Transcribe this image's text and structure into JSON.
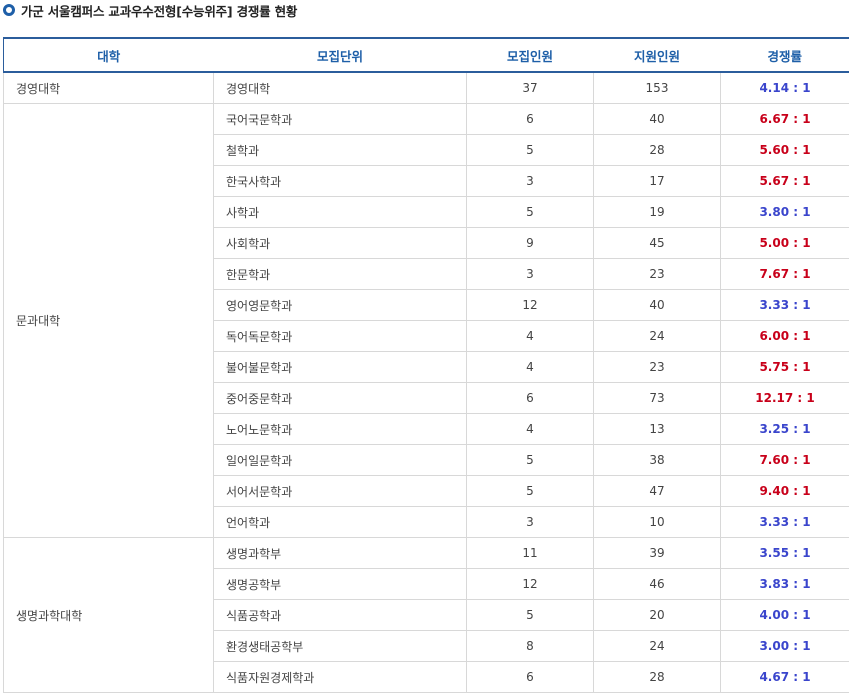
{
  "page": {
    "title": "가군 서울캠퍼스 교과우수전형[수능위주] 경쟁률 현황"
  },
  "table": {
    "headers": [
      "대학",
      "모집단위",
      "모집인원",
      "지원인원",
      "경쟁률"
    ],
    "colors": {
      "high": "#c8001a",
      "low": "#3a45cc",
      "header": "#1e5fa8"
    },
    "rows": [
      {
        "college": "경영대학",
        "rowspan": 1,
        "unit": "경영대학",
        "quota": "37",
        "applicants": "153",
        "ratio": "4.14 : 1",
        "level": "low"
      },
      {
        "college": "문과대학",
        "rowspan": 14,
        "unit": "국어국문학과",
        "quota": "6",
        "applicants": "40",
        "ratio": "6.67 : 1",
        "level": "high"
      },
      {
        "unit": "철학과",
        "quota": "5",
        "applicants": "28",
        "ratio": "5.60 : 1",
        "level": "high"
      },
      {
        "unit": "한국사학과",
        "quota": "3",
        "applicants": "17",
        "ratio": "5.67 : 1",
        "level": "high"
      },
      {
        "unit": "사학과",
        "quota": "5",
        "applicants": "19",
        "ratio": "3.80 : 1",
        "level": "low"
      },
      {
        "unit": "사회학과",
        "quota": "9",
        "applicants": "45",
        "ratio": "5.00 : 1",
        "level": "high"
      },
      {
        "unit": "한문학과",
        "quota": "3",
        "applicants": "23",
        "ratio": "7.67 : 1",
        "level": "high"
      },
      {
        "unit": "영어영문학과",
        "quota": "12",
        "applicants": "40",
        "ratio": "3.33 : 1",
        "level": "low"
      },
      {
        "unit": "독어독문학과",
        "quota": "4",
        "applicants": "24",
        "ratio": "6.00 : 1",
        "level": "high"
      },
      {
        "unit": "불어불문학과",
        "quota": "4",
        "applicants": "23",
        "ratio": "5.75 : 1",
        "level": "high"
      },
      {
        "unit": "중어중문학과",
        "quota": "6",
        "applicants": "73",
        "ratio": "12.17 : 1",
        "level": "high"
      },
      {
        "unit": "노어노문학과",
        "quota": "4",
        "applicants": "13",
        "ratio": "3.25 : 1",
        "level": "low"
      },
      {
        "unit": "일어일문학과",
        "quota": "5",
        "applicants": "38",
        "ratio": "7.60 : 1",
        "level": "high"
      },
      {
        "unit": "서어서문학과",
        "quota": "5",
        "applicants": "47",
        "ratio": "9.40 : 1",
        "level": "high"
      },
      {
        "unit": "언어학과",
        "quota": "3",
        "applicants": "10",
        "ratio": "3.33 : 1",
        "level": "low"
      },
      {
        "college": "생명과학대학",
        "rowspan": 5,
        "unit": "생명과학부",
        "quota": "11",
        "applicants": "39",
        "ratio": "3.55 : 1",
        "level": "low"
      },
      {
        "unit": "생명공학부",
        "quota": "12",
        "applicants": "46",
        "ratio": "3.83 : 1",
        "level": "low"
      },
      {
        "unit": "식품공학과",
        "quota": "5",
        "applicants": "20",
        "ratio": "4.00 : 1",
        "level": "low"
      },
      {
        "unit": "환경생태공학부",
        "quota": "8",
        "applicants": "24",
        "ratio": "3.00 : 1",
        "level": "low"
      },
      {
        "unit": "식품자원경제학과",
        "quota": "6",
        "applicants": "28",
        "ratio": "4.67 : 1",
        "level": "low"
      }
    ]
  }
}
